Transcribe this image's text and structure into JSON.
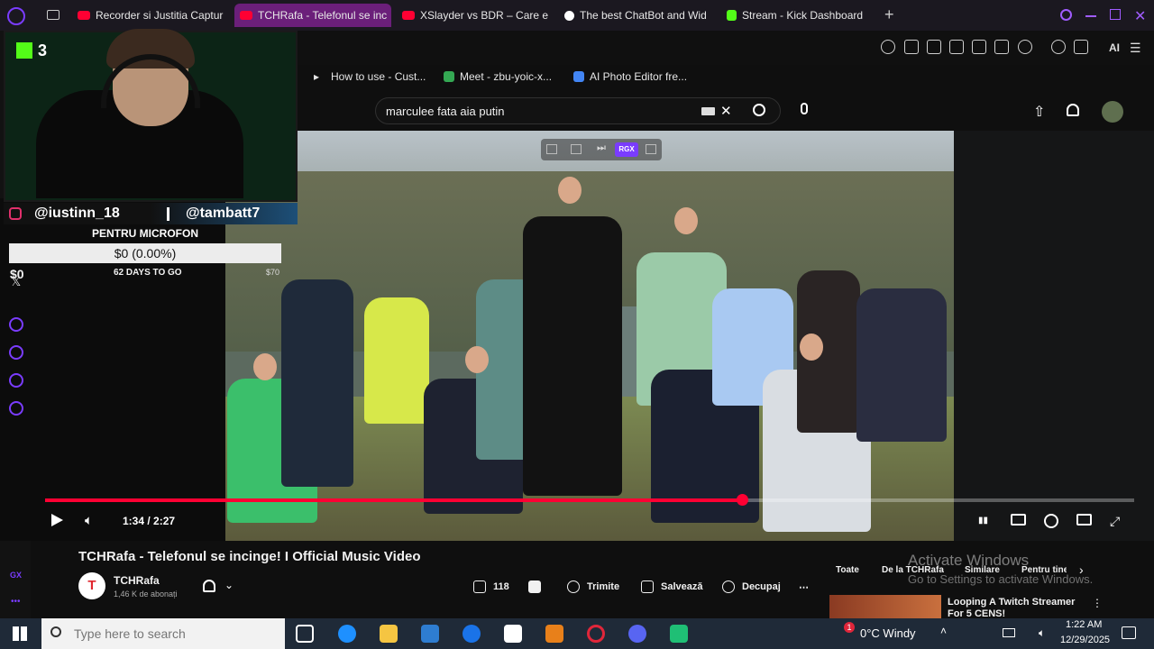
{
  "browser": {
    "tabs": [
      {
        "label": "Recorder si Justitia Captur",
        "color": "#ff0033"
      },
      {
        "label": "TCHRafa - Telefonul se inc",
        "color": "#ff0033",
        "active": true
      },
      {
        "label": "XSlayder vs BDR – Care e",
        "color": "#ff0033"
      },
      {
        "label": "The best ChatBot and Wid",
        "color": "#ffffff"
      },
      {
        "label": "Stream - Kick Dashboard",
        "color": "#53fc18"
      }
    ],
    "new_tab_label": "+",
    "bookmarks": [
      {
        "label": "How to use - Cust...",
        "color": "#9aa0a6"
      },
      {
        "label": "Meet - zbu-yoic-x...",
        "color": "#34a853"
      },
      {
        "label": "AI Photo Editor fre...",
        "color": "#4285f4"
      }
    ],
    "ai_label": "AI"
  },
  "youtube": {
    "search_value": "marculee fata aia putin",
    "player": {
      "time": "1:34 / 2:27",
      "progress_fraction": 0.64,
      "overlay_label": "RGX"
    },
    "video_title": "TCHRafa - Telefonul se incinge! I Official Music Video",
    "channel": {
      "avatar_letter": "T",
      "name": "TCHRafa",
      "subscribers": "1,46 K de abonați"
    },
    "actions": {
      "likes": "118",
      "share": "Trimite",
      "save": "Salvează",
      "clip": "Decupaj",
      "more": "⋯"
    },
    "chips": [
      "Toate",
      "De la TCHRafa",
      "Similare",
      "Pentru tine"
    ],
    "recommended": {
      "title": "Looping A Twitch Streamer For 5 CENS!"
    }
  },
  "stream_overlay": {
    "kick_count": "3",
    "instagram": "@iustinn_18",
    "tiktok": "@tambatt7",
    "donation": {
      "title": "PENTRU MICROFON",
      "amount": "$0 (0.00%)",
      "current": "$0",
      "days": "62 DAYS TO GO",
      "goal": "$70"
    },
    "left_label": "GX"
  },
  "watermark": {
    "line1": "Activate Windows",
    "line2": "Go to Settings to activate Windows."
  },
  "taskbar": {
    "search_placeholder": "Type here to search",
    "weather": "0°C  Windy",
    "time": "1:22 AM",
    "date": "12/29/2025",
    "notification_badge": "1"
  }
}
